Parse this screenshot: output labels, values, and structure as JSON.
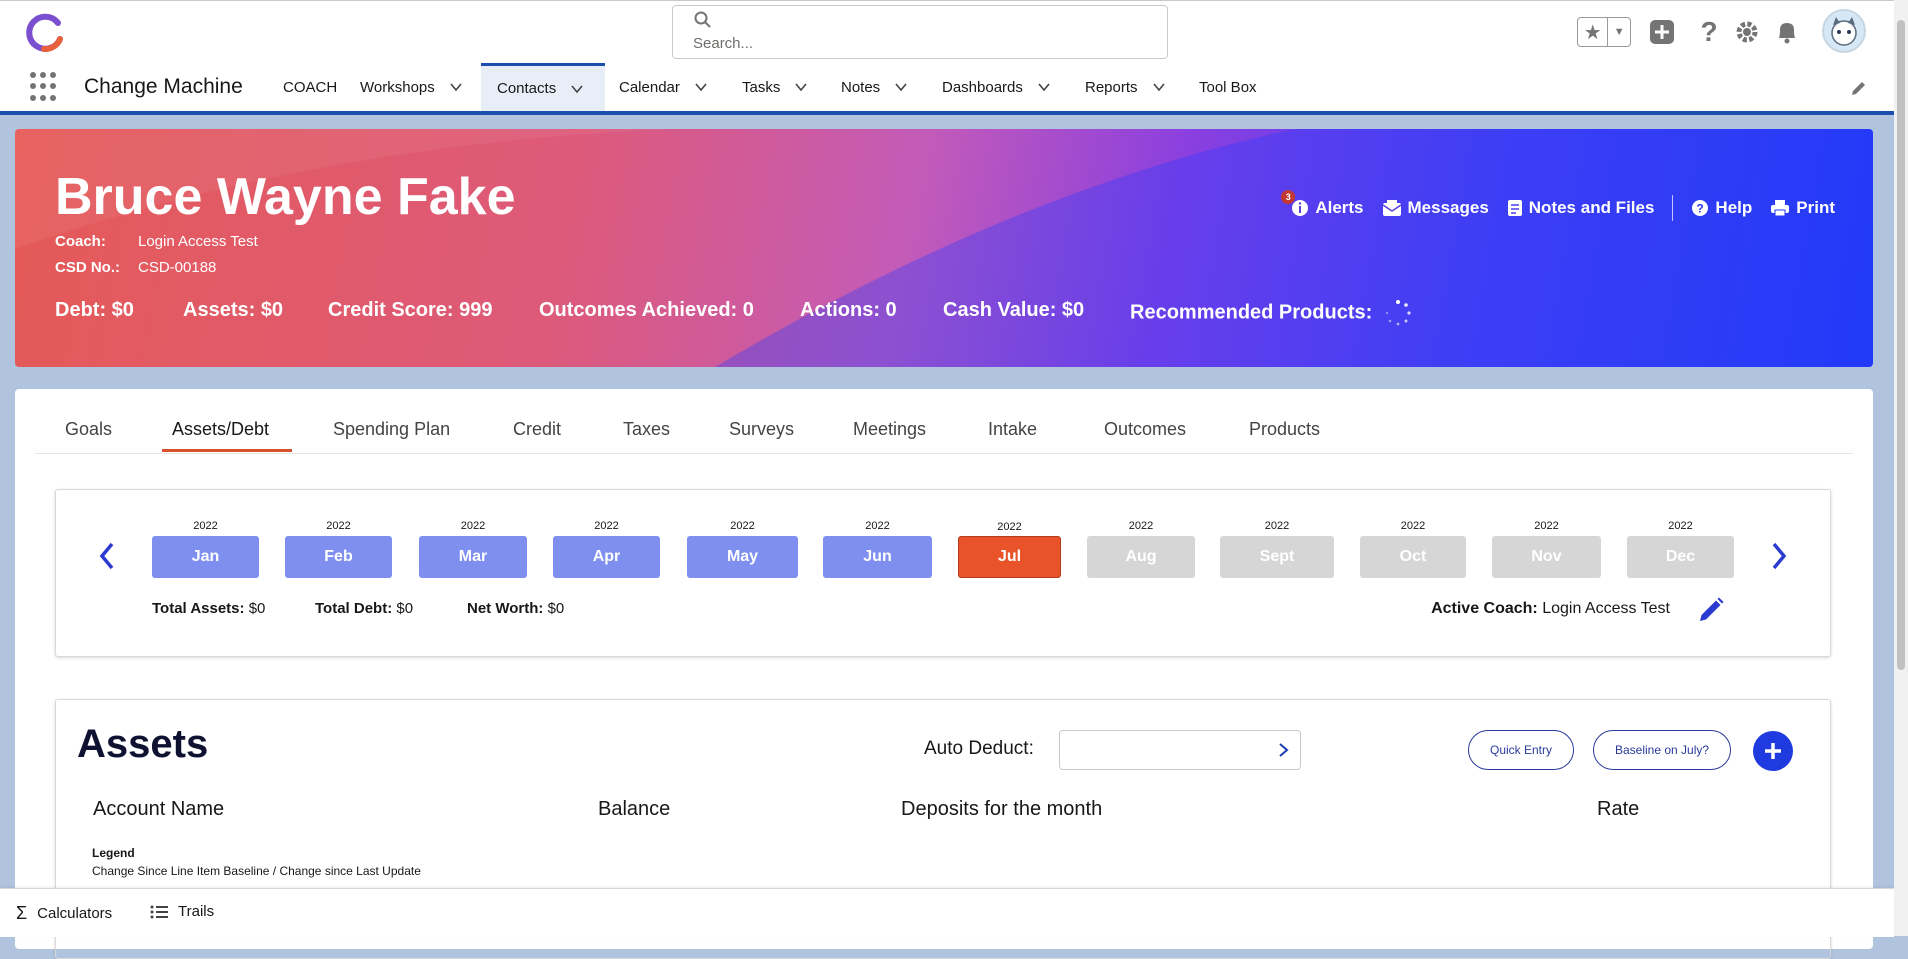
{
  "search": {
    "placeholder": "Search..."
  },
  "app": {
    "name": "Change Machine"
  },
  "nav": [
    {
      "label": "COACH",
      "dropdown": false
    },
    {
      "label": "Workshops",
      "dropdown": true
    },
    {
      "label": "Contacts",
      "dropdown": true,
      "active": true
    },
    {
      "label": "Calendar",
      "dropdown": true
    },
    {
      "label": "Tasks",
      "dropdown": true
    },
    {
      "label": "Notes",
      "dropdown": true
    },
    {
      "label": "Dashboards",
      "dropdown": true
    },
    {
      "label": "Reports",
      "dropdown": true
    },
    {
      "label": "Tool Box",
      "dropdown": false
    }
  ],
  "hero": {
    "name": "Bruce Wayne Fake",
    "coach_label": "Coach:",
    "coach_value": "Login Access Test",
    "csd_label": "CSD No.:",
    "csd_value": "CSD-00188",
    "stats": [
      "Debt: $0",
      "Assets: $0",
      "Credit Score: 999",
      "Outcomes Achieved: 0",
      "Actions: 0",
      "Cash Value: $0",
      "Recommended Products:"
    ],
    "actions": {
      "alerts_count": "3",
      "alerts": "Alerts",
      "messages": "Messages",
      "notes_files": "Notes and Files",
      "help": "Help",
      "print": "Print"
    }
  },
  "tabs": [
    "Goals",
    "Assets/Debt",
    "Spending Plan",
    "Credit",
    "Taxes",
    "Surveys",
    "Meetings",
    "Intake",
    "Outcomes",
    "Products"
  ],
  "months": [
    {
      "year": "2022",
      "label": "Jan",
      "state": "blue"
    },
    {
      "year": "2022",
      "label": "Feb",
      "state": "blue"
    },
    {
      "year": "2022",
      "label": "Mar",
      "state": "blue"
    },
    {
      "year": "2022",
      "label": "Apr",
      "state": "blue"
    },
    {
      "year": "2022",
      "label": "May",
      "state": "blue"
    },
    {
      "year": "2022",
      "label": "Jun",
      "state": "blue"
    },
    {
      "year": "2022",
      "label": "Jul",
      "state": "selected"
    },
    {
      "year": "2022",
      "label": "Aug",
      "state": "disabled"
    },
    {
      "year": "2022",
      "label": "Sept",
      "state": "disabled"
    },
    {
      "year": "2022",
      "label": "Oct",
      "state": "disabled"
    },
    {
      "year": "2022",
      "label": "Nov",
      "state": "disabled"
    },
    {
      "year": "2022",
      "label": "Dec",
      "state": "disabled"
    }
  ],
  "totals": {
    "assets_label": "Total Assets:",
    "assets_value": "$0",
    "debt_label": "Total Debt:",
    "debt_value": "$0",
    "net_label": "Net Worth:",
    "net_value": "$0",
    "coach_label": "Active Coach:",
    "coach_value": "Login Access Test"
  },
  "assets": {
    "title": "Assets",
    "auto_deduct_label": "Auto Deduct:",
    "quick_entry": "Quick Entry",
    "baseline": "Baseline on July?",
    "columns": [
      "Account Name",
      "Balance",
      "Deposits for the month",
      "Rate"
    ],
    "legend_title": "Legend",
    "legend_text": "Change Since Line Item Baseline / Change since Last Update"
  },
  "bottom": {
    "calculators": "Calculators",
    "trails": "Trails"
  },
  "colors": {
    "accent": "#1b4fae",
    "selected_month": "#e8532a",
    "month_blue": "#7e8ff0",
    "add_button": "#1f3be0"
  }
}
